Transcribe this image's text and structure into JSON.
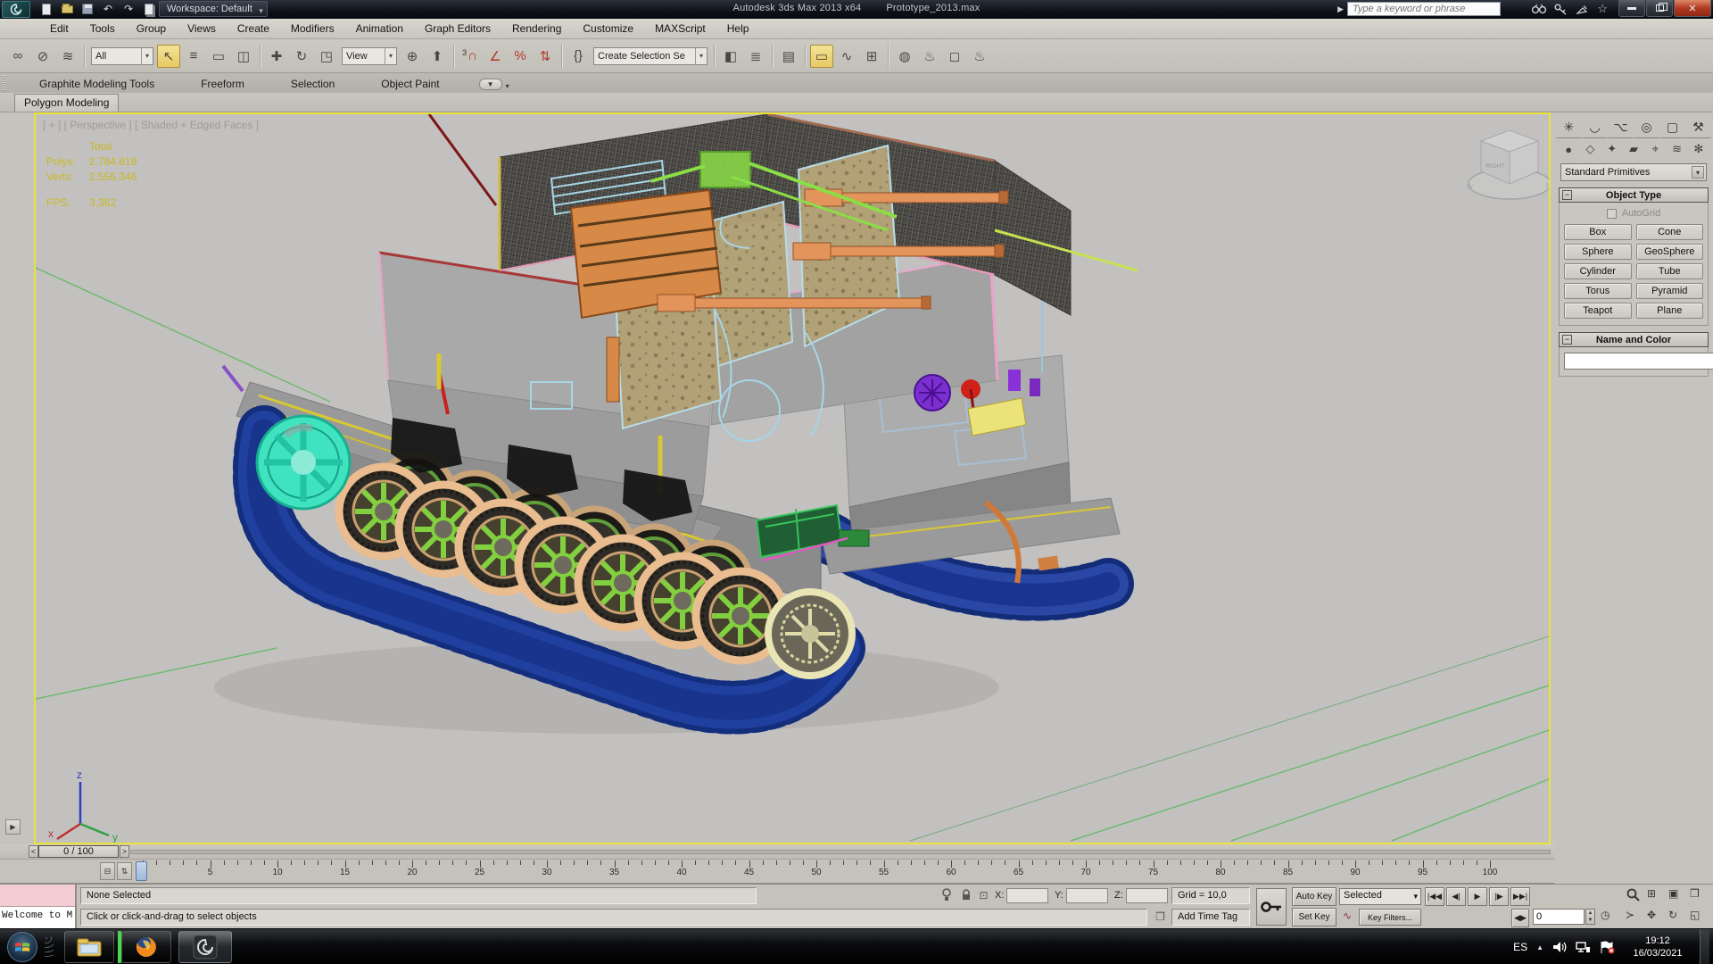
{
  "title_bar": {
    "app_title": "Autodesk 3ds Max 2013 x64",
    "file_title": "Prototype_2013.max",
    "workspace_label": "Workspace: Default",
    "search_placeholder": "Type a keyword or phrase"
  },
  "menu_bar": {
    "items": [
      "Edit",
      "Tools",
      "Group",
      "Views",
      "Create",
      "Modifiers",
      "Animation",
      "Graph Editors",
      "Rendering",
      "Customize",
      "MAXScript",
      "Help"
    ]
  },
  "toolbar": {
    "selection_filter_value": "All",
    "reference_coordsys_value": "View",
    "named_selection_value": "Create Selection Se",
    "snap_label": "3",
    "icons": {
      "link": "∞",
      "unlink": "⊘",
      "bind": "≋",
      "select": "↖",
      "select_by_name": "≡",
      "rect_region": "▭",
      "window_crossing": "◫",
      "move": "✚",
      "rotate": "↻",
      "scale": "◳",
      "manipulate": "⊕",
      "kbd_override": "⌨",
      "snap_magnet": "∩",
      "angle_snap": "∠",
      "percent_snap": "%",
      "spinner_snap": "⇅",
      "named_sets": "{}",
      "mirror": "◧",
      "align": "≣",
      "layers": "▤",
      "ribbon_toggle": "▭",
      "curve_editor": "∿",
      "schematic": "⊞",
      "material_editor": "◍",
      "render_setup": "♨",
      "rendered_frame": "◻",
      "render": "♨"
    }
  },
  "ribbon": {
    "tabs": [
      "Graphite Modeling Tools",
      "Freeform",
      "Selection",
      "Object Paint"
    ],
    "active_tab": "Graphite Modeling Tools",
    "subtab": "Polygon Modeling"
  },
  "viewport": {
    "label": "[ + ] [ Perspective ] [ Shaded + Edged Faces ]",
    "stats": {
      "total_label": "Total",
      "polys_label": "Polys:",
      "polys_value": "2.784.819",
      "verts_label": "Verts:",
      "verts_value": "2.556.346",
      "fps_label": "FPS:",
      "fps_value": "3,382"
    },
    "axis": {
      "x": "x",
      "y": "y",
      "z": "z"
    },
    "viewcube_face": "RIGHT"
  },
  "command_panel": {
    "tabs": [
      {
        "name": "create",
        "glyph": "✳"
      },
      {
        "name": "modify",
        "glyph": "◡"
      },
      {
        "name": "hierarchy",
        "glyph": "⌥"
      },
      {
        "name": "motion",
        "glyph": "◎"
      },
      {
        "name": "display",
        "glyph": "▢"
      },
      {
        "name": "utilities",
        "glyph": "⚒"
      }
    ],
    "categories": [
      {
        "name": "geometry",
        "glyph": "●"
      },
      {
        "name": "shapes",
        "glyph": "◇"
      },
      {
        "name": "lights",
        "glyph": "✦"
      },
      {
        "name": "cameras",
        "glyph": "▰"
      },
      {
        "name": "helpers",
        "glyph": "⌖"
      },
      {
        "name": "spacewarps",
        "glyph": "≋"
      },
      {
        "name": "systems",
        "glyph": "✻"
      }
    ],
    "category_dropdown": "Standard Primitives",
    "object_type": {
      "title": "Object Type",
      "autogrid_label": "AutoGrid",
      "buttons": [
        "Box",
        "Cone",
        "Sphere",
        "GeoSphere",
        "Cylinder",
        "Tube",
        "Torus",
        "Pyramid",
        "Teapot",
        "Plane"
      ]
    },
    "name_color": {
      "title": "Name and Color",
      "swatch_color": "#d6318e"
    }
  },
  "timeline": {
    "slider_value": "0 / 100",
    "start": 0,
    "end": 100,
    "label_step": 5
  },
  "status_bar": {
    "listener_text": "Welcome to M",
    "selection_status": "None Selected",
    "prompt": "Click or click-and-drag to select objects",
    "x_label": "X:",
    "y_label": "Y:",
    "z_label": "Z:",
    "grid_display": "Grid = 10,0",
    "add_time_tag": "Add Time Tag",
    "auto_key": "Auto Key",
    "set_key": "Set Key",
    "key_mode_dropdown": "Selected",
    "key_filters": "Key Filters...",
    "frame_field": "0",
    "playback": {
      "go_start": "|◀◀",
      "prev": "◀|",
      "play": "▶",
      "next": "|▶",
      "go_end": "▶▶|"
    }
  },
  "taskbar": {
    "language": "ES",
    "time": "19:12",
    "date": "16/03/2021"
  },
  "colors": {
    "accent_yellow": "#e9e43a",
    "stats_yellow": "#c9b821"
  }
}
